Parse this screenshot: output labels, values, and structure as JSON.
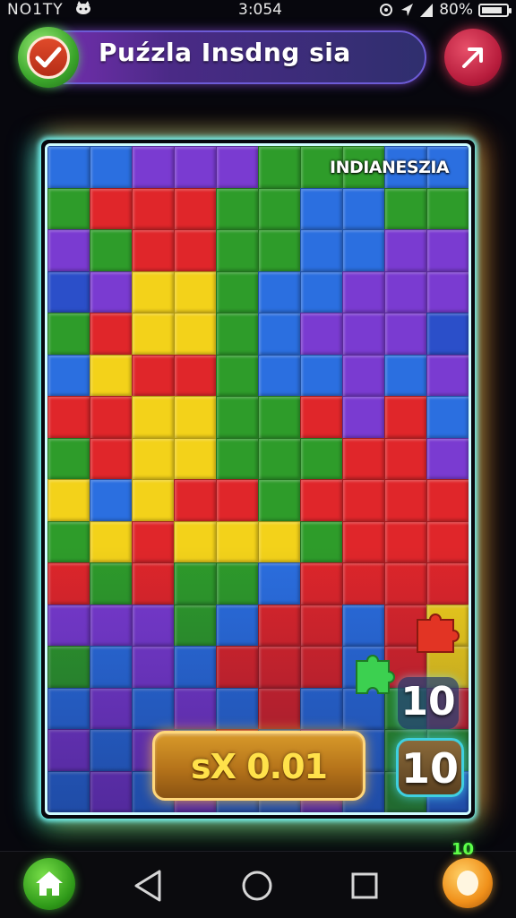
{
  "status_bar": {
    "left_text": "NO1TY",
    "time": "3:054",
    "battery": "80%",
    "notification_icon": "cat-icon",
    "right_icons": [
      "sync-icon",
      "location-icon",
      "signal-icon"
    ]
  },
  "header": {
    "title": "Puźzla Insdng sia",
    "left_badge_icon": "checkmark-icon",
    "right_button_icon": "arrow-up-right-icon"
  },
  "board": {
    "label": "INDIANESZIA",
    "piece_colors": [
      "#2e9c2a",
      "#2b6fe0",
      "#7a3bd1",
      "#e0262a",
      "#f3d21a",
      "#2b4fc9"
    ]
  },
  "scores": {
    "top_value": "10",
    "bottom_value": "10",
    "multiplier": "sX 0.01"
  },
  "bottom_nav": {
    "home_icon": "home-icon",
    "back_icon": "back-triangle-icon",
    "home_circle_icon": "circle-icon",
    "recents_icon": "square-icon",
    "coin_icon": "coin-icon",
    "coin_badge": "10"
  },
  "colors": {
    "accent_glow": "#7ffcff",
    "gold": "#f3d21a",
    "green": "#2e9c2a"
  }
}
